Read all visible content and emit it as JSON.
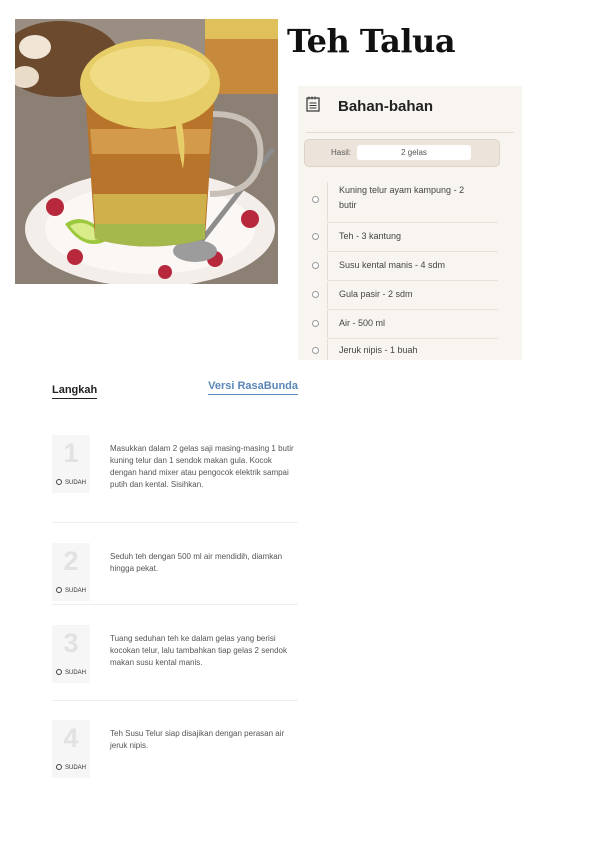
{
  "recipe": {
    "title": "Teh Talua",
    "photo_icon": "egg-tea-photo"
  },
  "ingredients": {
    "heading": "Bahan-bahan",
    "heading_icon": "notepad-icon",
    "yield_label": "Hasil:",
    "yield_value": "2 gelas",
    "items": [
      "Kuning telur ayam kampung - 2 butir",
      "Teh - 3 kantung",
      "Susu kental manis - 4 sdm",
      "Gula pasir - 2 sdm",
      "Air - 500 ml",
      "Jeruk nipis - 1 buah"
    ]
  },
  "steps": {
    "tab_active": "Langkah",
    "tab_other": "Versi RasaBunda",
    "done_label": "SUDAH",
    "items": [
      {
        "number": "1",
        "text": "Masukkan dalam 2 gelas saji masing-masing 1 butir kuning telur dan 1 sendok makan gula. Kocok dengan hand mixer atau pengocok elektrik sampai putih dan kental. Sisihkan."
      },
      {
        "number": "2",
        "text": "Seduh teh dengan 500 ml air mendidih, diamkan hingga pekat."
      },
      {
        "number": "3",
        "text": "Tuang seduhan teh ke dalam gelas yang berisi kocokan telur, lalu tambahkan tiap gelas 2 sendok makan susu kental manis."
      },
      {
        "number": "4",
        "text": "Teh Susu Telur siap disajikan dengan perasan air jeruk nipis."
      }
    ]
  }
}
